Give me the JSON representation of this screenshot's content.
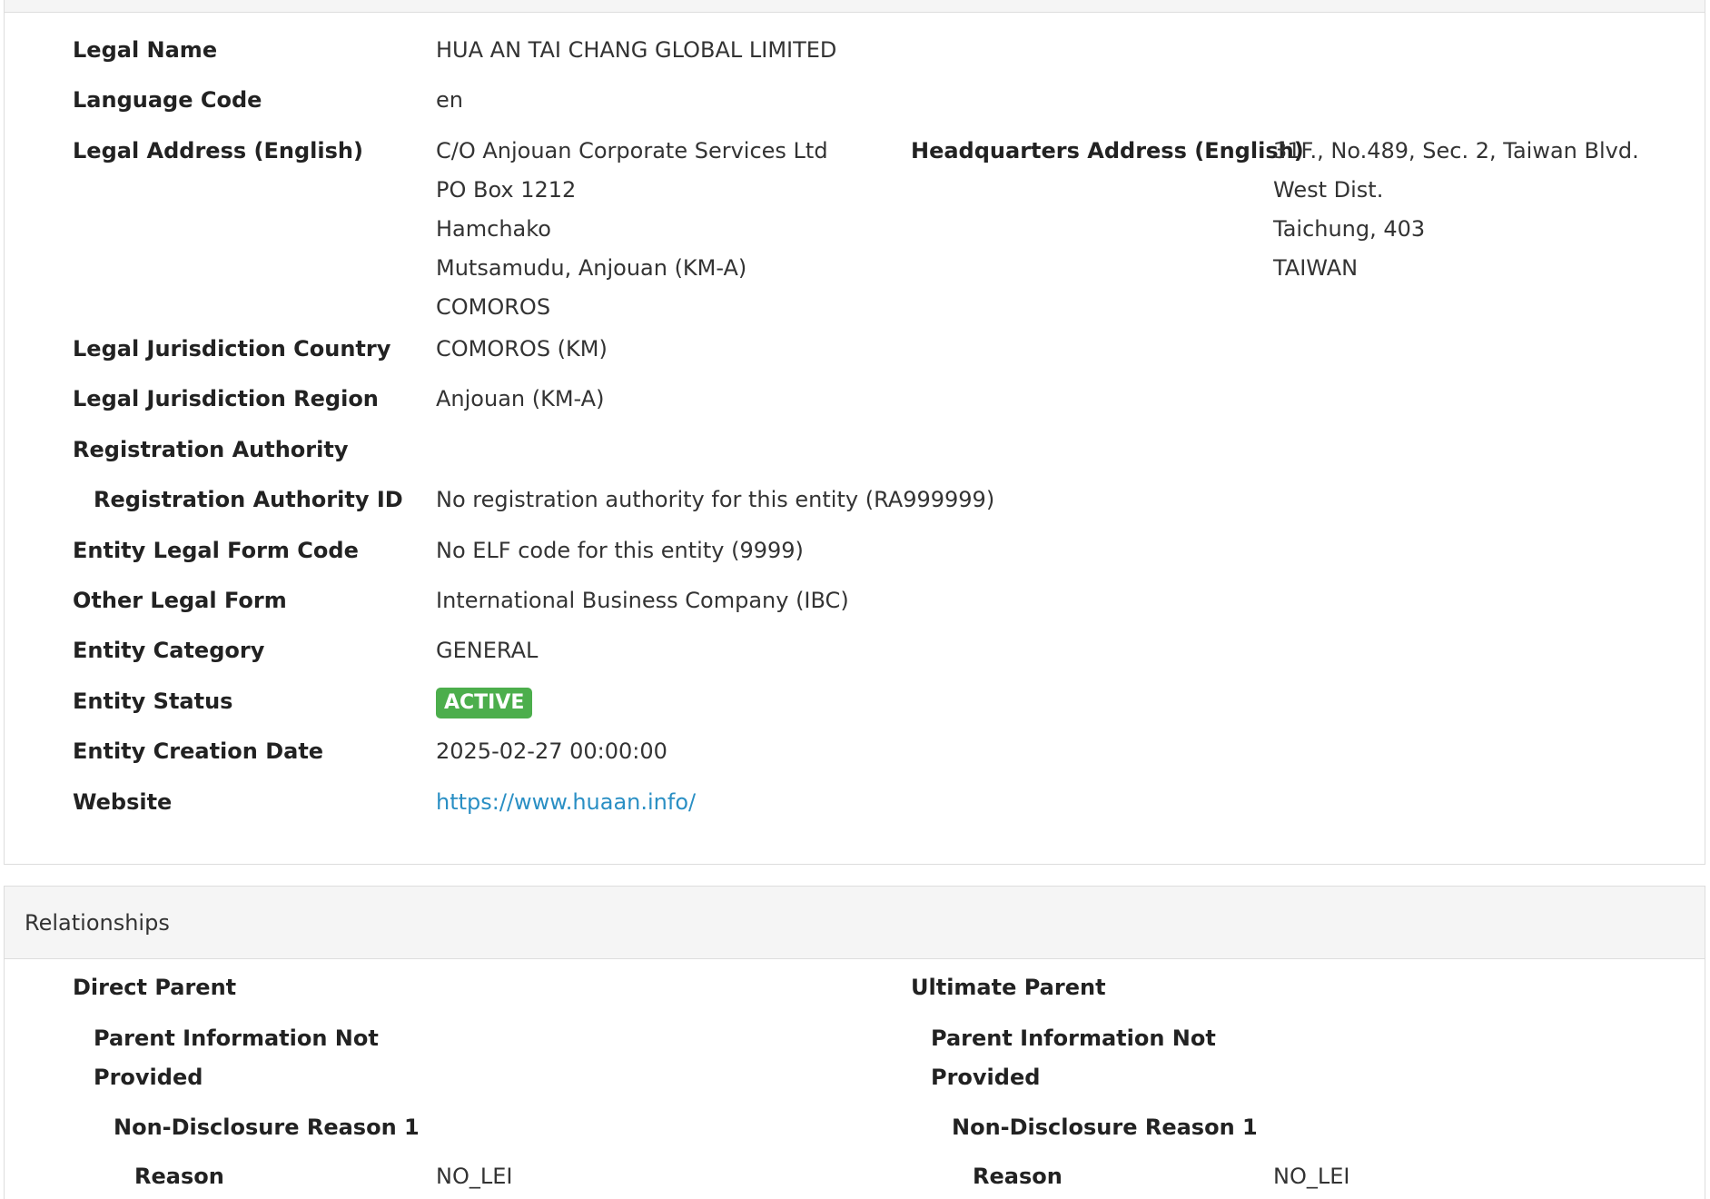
{
  "entity": {
    "legal_name": {
      "label": "Legal Name",
      "value": "HUA AN TAI CHANG GLOBAL LIMITED"
    },
    "language_code": {
      "label": "Language Code",
      "value": "en"
    },
    "legal_address": {
      "label": "Legal Address (English)",
      "lines": [
        "C/O Anjouan Corporate Services Ltd",
        "PO Box 1212",
        "Hamchako",
        "Mutsamudu, Anjouan (KM-A)",
        "COMOROS"
      ]
    },
    "hq_address": {
      "label": "Headquarters Address (English)",
      "lines": [
        "31F., No.489, Sec. 2, Taiwan Blvd.",
        "West Dist.",
        "Taichung, 403",
        "TAIWAN"
      ]
    },
    "jurisdiction_country": {
      "label": "Legal Jurisdiction Country",
      "value": "COMOROS (KM)"
    },
    "jurisdiction_region": {
      "label": "Legal Jurisdiction Region",
      "value": "Anjouan (KM-A)"
    },
    "registration_authority": {
      "label": "Registration Authority"
    },
    "registration_authority_id": {
      "label": "Registration Authority ID",
      "value": "No registration authority for this entity (RA999999)"
    },
    "elf_code": {
      "label": "Entity Legal Form Code",
      "value": "No ELF code for this entity (9999)"
    },
    "other_legal_form": {
      "label": "Other Legal Form",
      "value": "International Business Company (IBC)"
    },
    "category": {
      "label": "Entity Category",
      "value": "GENERAL"
    },
    "status": {
      "label": "Entity Status",
      "value": "ACTIVE",
      "color": "#4cae4c"
    },
    "creation_date": {
      "label": "Entity Creation Date",
      "value": "2025-02-27 00:00:00"
    },
    "website": {
      "label": "Website",
      "value": "https://www.huaan.info/"
    }
  },
  "relationships": {
    "heading": "Relationships",
    "direct": {
      "title": "Direct Parent",
      "info_line1": "Parent Information Not",
      "info_line2": "Provided",
      "reason_heading": "Non-Disclosure Reason 1",
      "reason_label": "Reason",
      "reason_value": "NO_LEI"
    },
    "ultimate": {
      "title": "Ultimate Parent",
      "info_line1": "Parent Information Not",
      "info_line2": "Provided",
      "reason_heading": "Non-Disclosure Reason 1",
      "reason_label": "Reason",
      "reason_value": "NO_LEI"
    }
  }
}
